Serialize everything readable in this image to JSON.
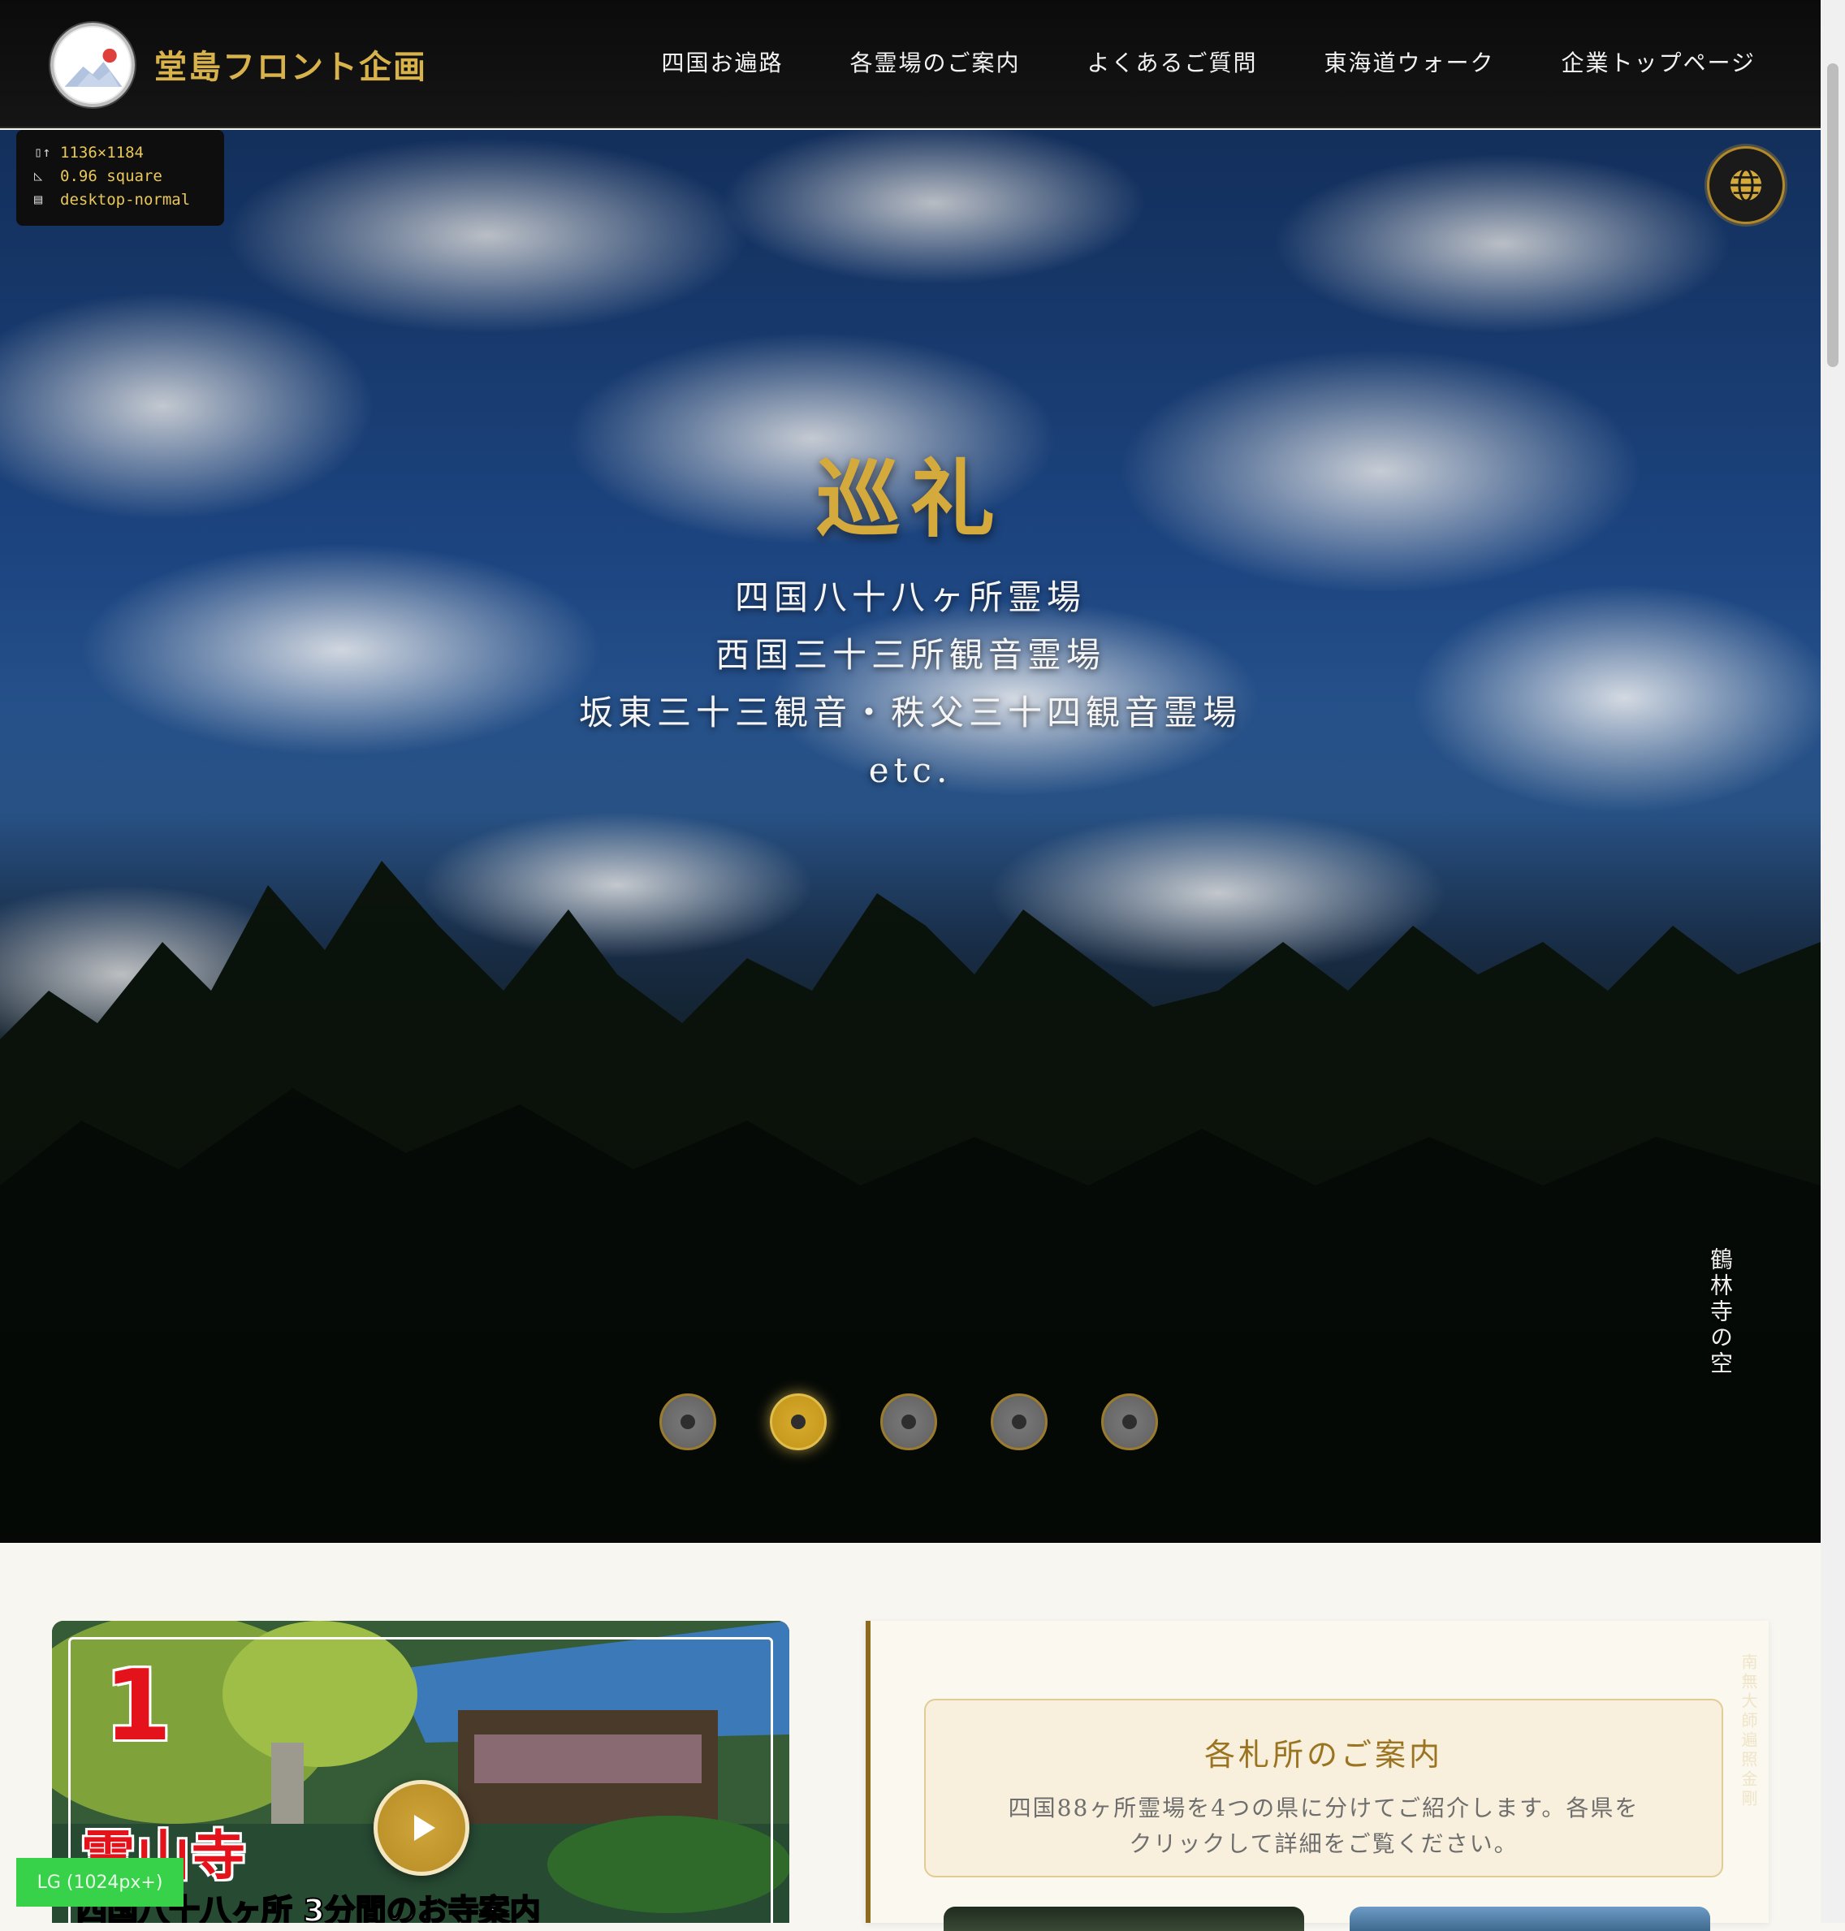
{
  "header": {
    "brand": "堂島フロント企画",
    "logo_text": "堂島フロント",
    "nav": [
      {
        "label": "四国お遍路"
      },
      {
        "label": "各霊場のご案内"
      },
      {
        "label": "よくあるご質問"
      },
      {
        "label": "東海道ウォーク"
      },
      {
        "label": "企業トップページ"
      }
    ]
  },
  "debug": {
    "viewport": "1136×1184",
    "ratio": "0.96 square",
    "mode": "desktop-normal"
  },
  "hero": {
    "title": "巡礼",
    "lines": [
      "四国八十八ヶ所霊場",
      "西国三十三所観音霊場",
      "坂東三十三観音・秩父三十四観音霊場",
      "etc."
    ],
    "caption": "鶴林寺の空",
    "slides": 5,
    "active_slide": 2,
    "globe_icon": "globe-icon"
  },
  "video": {
    "number": "1",
    "temple": "霊山寺",
    "subtitle": "四国八十八ヶ所 3分間のお寺案内"
  },
  "badge": {
    "breakpoint": "LG (1024px+)"
  },
  "guide": {
    "title": "各札所のご案内",
    "description": "四国88ヶ所霊場を4つの県に分けてご紹介します。各県をクリックして詳細をご覧ください。"
  },
  "colors": {
    "gold": "#d4aa3d",
    "header_bg": "#0b0b0b",
    "panel_bg": "#fbf8ef"
  }
}
